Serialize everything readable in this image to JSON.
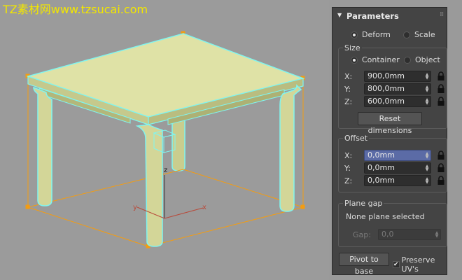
{
  "watermark": "TZ素材网www.tzsucai.com",
  "viewport": {
    "axis_labels": {
      "z": "z",
      "y": "y",
      "x": "x"
    }
  },
  "panel": {
    "title": "Parameters",
    "mode": {
      "deform_label": "Deform",
      "scale_label": "Scale",
      "selected": "Deform"
    },
    "size": {
      "label": "Size",
      "container_label": "Container",
      "object_label": "Object",
      "selected": "Container",
      "x_label": "X:",
      "x_value": "900,0mm",
      "y_label": "Y:",
      "y_value": "800,0mm",
      "z_label": "Z:",
      "z_value": "600,0mm",
      "reset_label": "Reset dimensions"
    },
    "offset": {
      "label": "Offset",
      "x_label": "X:",
      "x_value": "0,0mm",
      "y_label": "Y:",
      "y_value": "0,0mm",
      "z_label": "Z:",
      "z_value": "0,0mm"
    },
    "plane_gap": {
      "label": "Plane gap",
      "status": "None plane selected",
      "gap_label": "Gap:",
      "gap_value": "0,0"
    },
    "pivot_label": "Pivot to base",
    "preserve_uv_label": "Preserve UV's",
    "preserve_uv_checked": true
  },
  "colors": {
    "viewport_bg": "#9b9b9b",
    "table_top": "#d9dca0",
    "table_side": "#c2c68a",
    "selection_outline": "#7ff5f0",
    "bounding_box": "#f39c12",
    "panel_bg": "#444444",
    "active_field": "#5b6ba6",
    "watermark": "#f2e600"
  }
}
